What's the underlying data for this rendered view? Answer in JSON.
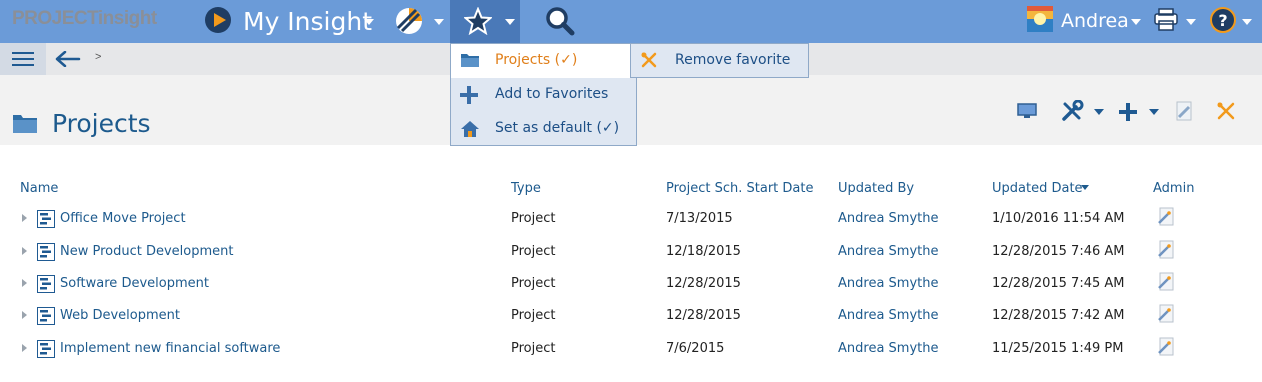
{
  "topbar": {
    "logo_text": "PROJECTinsight",
    "app_title": "My Insight",
    "user_name": "Andrea"
  },
  "favorites_menu": {
    "items": [
      {
        "label": "Projects (✓)",
        "icon": "folder-icon",
        "active": true
      },
      {
        "label": "Add to Favorites",
        "icon": "plus-icon",
        "active": false
      },
      {
        "label": "Set as default (✓)",
        "icon": "home-icon",
        "active": false
      }
    ],
    "submenu": {
      "label": "Remove favorite",
      "icon": "remove-x-icon"
    }
  },
  "breadcrumb": {
    "separator": ">"
  },
  "page": {
    "title": "Projects"
  },
  "table": {
    "columns": [
      "Name",
      "Type",
      "Project Sch. Start Date",
      "Updated By",
      "Updated Date",
      "Admin"
    ],
    "sorted_column": "Updated Date",
    "sort_direction": "descending",
    "rows": [
      {
        "name": "Office Move Project",
        "type": "Project",
        "start": "7/13/2015",
        "updated_by": "Andrea Smythe",
        "updated_date": "1/10/2016 11:54 AM"
      },
      {
        "name": "New Product Development",
        "type": "Project",
        "start": "12/18/2015",
        "updated_by": "Andrea Smythe",
        "updated_date": "12/28/2015 7:46 AM"
      },
      {
        "name": "Software Development",
        "type": "Project",
        "start": "12/28/2015",
        "updated_by": "Andrea Smythe",
        "updated_date": "12/28/2015 7:45 AM"
      },
      {
        "name": "Web Development",
        "type": "Project",
        "start": "12/28/2015",
        "updated_by": "Andrea Smythe",
        "updated_date": "12/28/2015 7:42 AM"
      },
      {
        "name": "Implement new financial software",
        "type": "Project",
        "start": "7/6/2015",
        "updated_by": "Andrea Smythe",
        "updated_date": "11/25/2015 1:49 PM"
      }
    ]
  },
  "colors": {
    "topbar": "#6b9bd8",
    "topbar_active": "#4a79b8",
    "link": "#1d5a8d",
    "accent_orange": "#e07f1a"
  }
}
